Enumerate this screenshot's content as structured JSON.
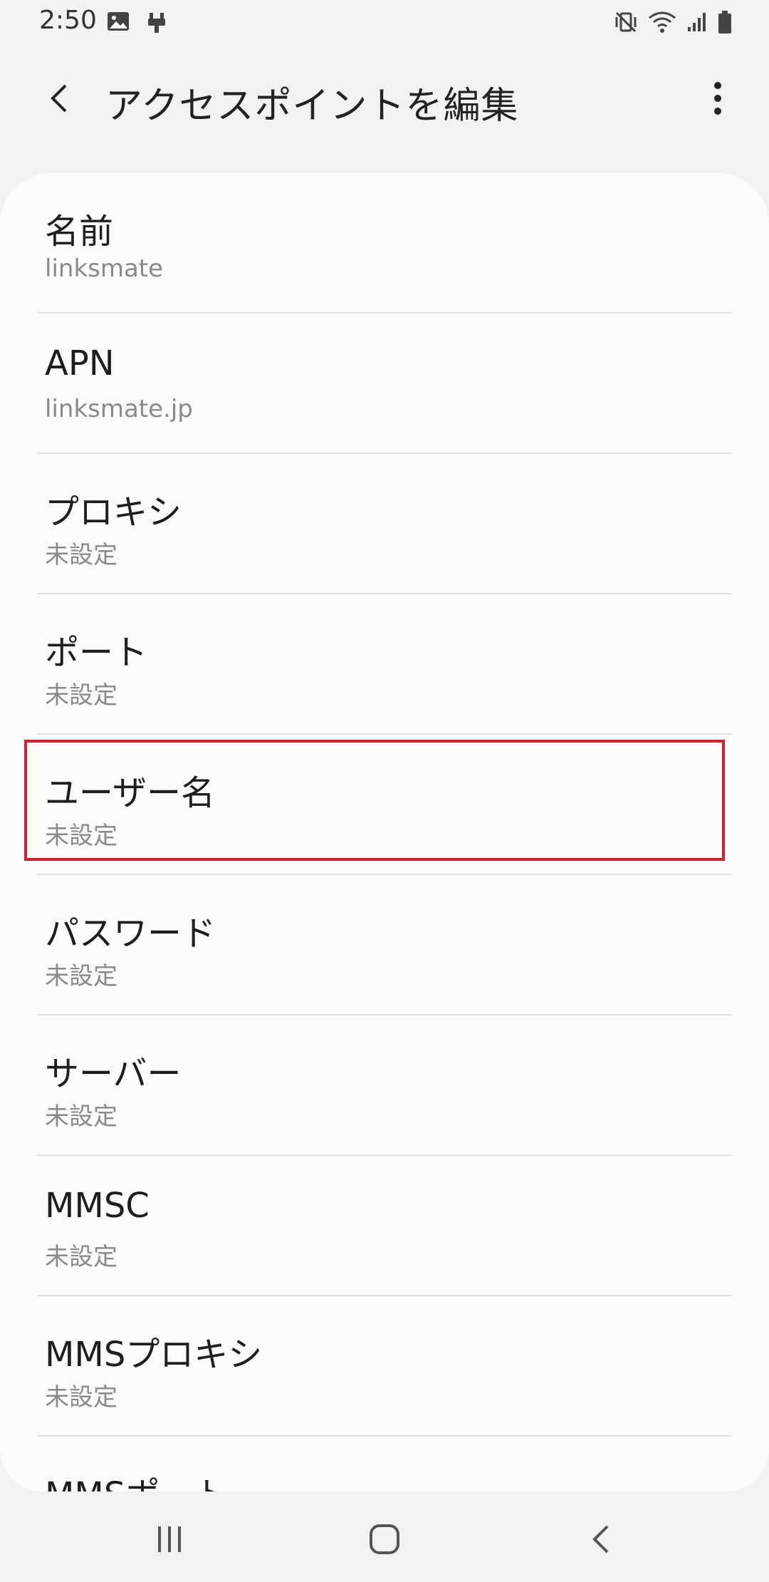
{
  "status_bar": {
    "time": "2:50",
    "left_icons": [
      "image-icon",
      "usb-icon"
    ],
    "right_icons": [
      "vibrate-icon",
      "wifi-icon",
      "signal-icon",
      "battery-icon"
    ]
  },
  "app_bar": {
    "title": "アクセスポイントを編集",
    "back_icon": "chevron-left-icon",
    "more_icon": "more-vert-icon"
  },
  "list": {
    "items": [
      {
        "title": "名前",
        "value": "linksmate"
      },
      {
        "title": "APN",
        "value": "linksmate.jp"
      },
      {
        "title": "プロキシ",
        "value": "未設定"
      },
      {
        "title": "ポート",
        "value": "未設定"
      },
      {
        "title": "ユーザー名",
        "value": "未設定"
      },
      {
        "title": "パスワード",
        "value": "未設定"
      },
      {
        "title": "サーバー",
        "value": "未設定"
      },
      {
        "title": "MMSC",
        "value": "未設定"
      },
      {
        "title": "MMSプロキシ",
        "value": "未設定"
      },
      {
        "title": "MMSポート",
        "value": ""
      }
    ]
  },
  "highlight": {
    "color": "#d81e2c",
    "target": "ユーザー名"
  },
  "nav_bar": {
    "icons": [
      "recent-apps-icon",
      "home-icon",
      "back-icon"
    ]
  }
}
